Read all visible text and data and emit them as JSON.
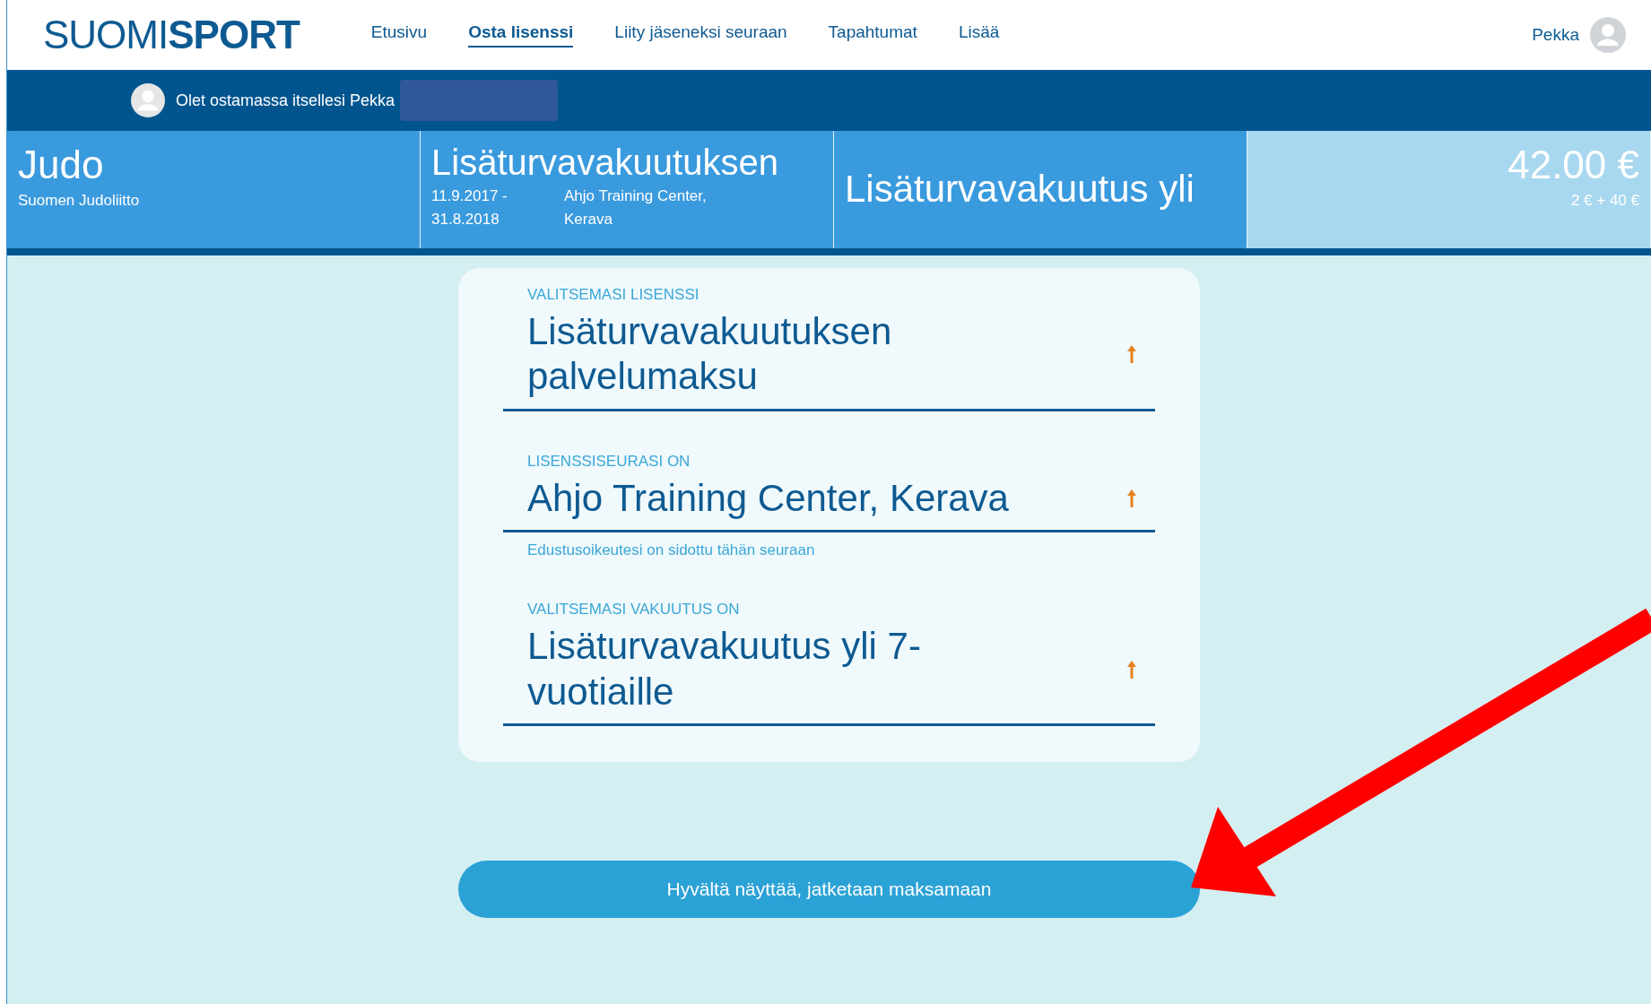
{
  "header": {
    "logo": {
      "light": "SUOMI",
      "bold": "SPORT"
    },
    "nav": [
      {
        "label": "Etusivu",
        "selected": false
      },
      {
        "label": "Osta lisenssi",
        "selected": true
      },
      {
        "label": "Liity jäseneksi seuraan",
        "selected": false
      },
      {
        "label": "Tapahtumat",
        "selected": false
      },
      {
        "label": "Lisää",
        "selected": false
      }
    ],
    "user": "Pekka"
  },
  "buyer_bar": {
    "text": "Olet ostamassa itsellesi Pekka"
  },
  "summary": {
    "sport": "Judo",
    "federation": "Suomen Judoliitto",
    "license": "Lisäturvavakuutuksen",
    "period": "11.9.2017 - 31.8.2018",
    "club": "Ahjo Training Center, Kerava",
    "insurance": "Lisäturvavakuutus yli",
    "price": "42.00 €",
    "price_breakdown": "2 € + 40 €"
  },
  "fields": [
    {
      "label": "VALITSEMASI LISENSSI",
      "value": "Lisäturvavakuutuksen palvelumaksu"
    },
    {
      "label": "LISENSSISEURASI ON",
      "value": "Ahjo Training Center, Kerava",
      "hint": "Edustusoikeutesi on sidottu tähän seuraan"
    },
    {
      "label": "VALITSEMASI VAKUUTUS ON",
      "value": "Lisäturvavakuutus yli 7-vuotiaille"
    }
  ],
  "continue_button": "Hyvältä näyttää, jatketaan maksamaan"
}
